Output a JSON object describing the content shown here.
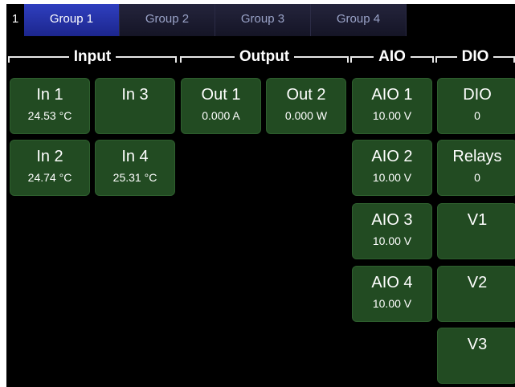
{
  "tabs": {
    "index": "1",
    "items": [
      {
        "label": "Group 1"
      },
      {
        "label": "Group 2"
      },
      {
        "label": "Group 3"
      },
      {
        "label": "Group 4"
      }
    ],
    "active": "Group 1"
  },
  "sections": {
    "input": "Input",
    "output": "Output",
    "aio": "AIO",
    "dio": "DIO"
  },
  "tiles": {
    "in1": {
      "name": "In 1",
      "value": "24.53 °C"
    },
    "in2": {
      "name": "In 2",
      "value": "24.74 °C"
    },
    "in3": {
      "name": "In 3",
      "value": ""
    },
    "in4": {
      "name": "In 4",
      "value": "25.31 °C"
    },
    "out1": {
      "name": "Out 1",
      "value": "0.000 A"
    },
    "out2": {
      "name": "Out 2",
      "value": "0.000 W"
    },
    "aio1": {
      "name": "AIO 1",
      "value": "10.00 V"
    },
    "aio2": {
      "name": "AIO 2",
      "value": "10.00 V"
    },
    "aio3": {
      "name": "AIO 3",
      "value": "10.00 V"
    },
    "aio4": {
      "name": "AIO 4",
      "value": "10.00 V"
    },
    "dio": {
      "name": "DIO",
      "value": "0"
    },
    "relays": {
      "name": "Relays",
      "value": "0"
    },
    "v1": {
      "name": "V1",
      "value": ""
    },
    "v2": {
      "name": "V2",
      "value": ""
    },
    "v3": {
      "name": "V3",
      "value": ""
    }
  },
  "colors": {
    "tile_bg": "#224b22",
    "tab_active": "#2f3fbf",
    "background": "#000000"
  }
}
